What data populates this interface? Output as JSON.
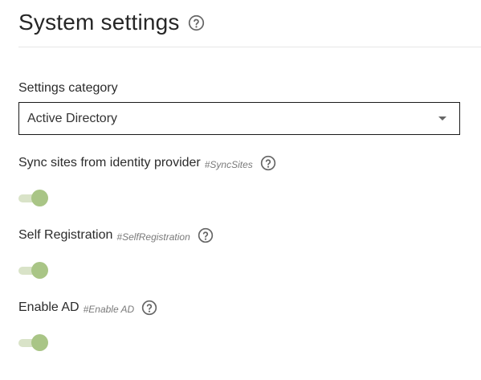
{
  "header": {
    "title": "System settings",
    "help_icon": "help-circle-icon"
  },
  "category": {
    "label": "Settings category",
    "selected": "Active Directory"
  },
  "settings": [
    {
      "label": "Sync sites from identity provider",
      "key": "#SyncSites",
      "enabled": true
    },
    {
      "label": "Self Registration",
      "key": "#SelfRegistration",
      "enabled": true
    },
    {
      "label": "Enable AD",
      "key": "#Enable AD",
      "enabled": true
    }
  ],
  "colors": {
    "toggle_track_on": "#d9e3c8",
    "toggle_knob_on": "#a9c586",
    "divider": "#e6e6e6"
  }
}
